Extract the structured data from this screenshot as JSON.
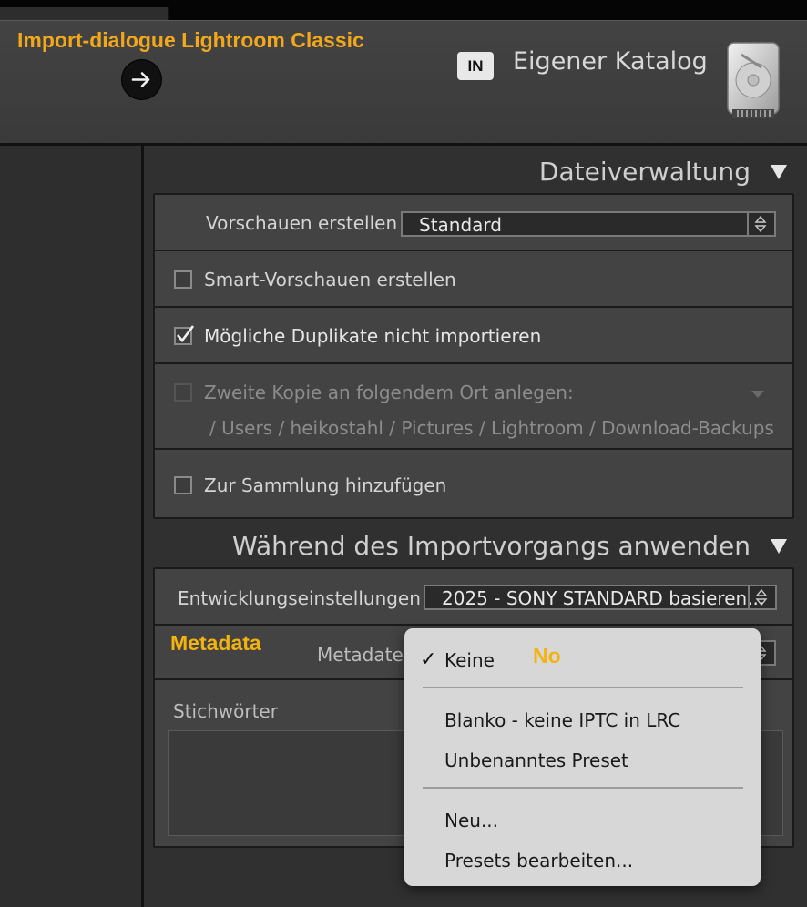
{
  "annotations": {
    "title": "Import-dialogue Lightroom Classic",
    "metadata_label": "Metadata",
    "no_label": "No"
  },
  "header": {
    "badge": "IN",
    "catalog": "Eigener Katalog"
  },
  "file_handling": {
    "title": "Dateiverwaltung",
    "build_previews_label": "Vorschauen erstellen",
    "build_previews_value": "Standard",
    "smart_previews_label": "Smart-Vorschauen erstellen",
    "smart_previews_checked": false,
    "no_duplicates_label": "Mögliche Duplikate nicht importieren",
    "no_duplicates_checked": true,
    "second_copy_label": "Zweite Kopie an folgendem Ort anlegen:",
    "second_copy_path": "/ Users / heikostahl / Pictures / Lightroom / Download-Backups",
    "second_copy_checked": false,
    "add_to_collection_label": "Zur Sammlung hinzufügen",
    "add_to_collection_checked": false
  },
  "apply_during_import": {
    "title": "Während des Importvorgangs anwenden",
    "develop_label": "Entwicklungseinstellungen",
    "develop_value": "2025 - SONY STANDARD basieren...",
    "metadata_label": "Metadaten",
    "keywords_label": "Stichwörter"
  },
  "metadata_menu": {
    "items": [
      {
        "label": "Keine",
        "checked": true
      },
      {
        "label": "Blanko - keine IPTC in LRC"
      },
      {
        "label": "Unbenanntes Preset"
      },
      {
        "label": "Neu..."
      },
      {
        "label": "Presets bearbeiten..."
      }
    ],
    "check_glyph": "✓"
  },
  "colors": {
    "annotation": "#f3a81b",
    "panel": "#434343",
    "menu": "#d7d7d7"
  },
  "icons": {
    "arrow": "arrow-right-icon",
    "disk": "hard-disk-icon",
    "collapse": "triangle-down-icon",
    "stepper": "up-down-stepper-icon"
  }
}
